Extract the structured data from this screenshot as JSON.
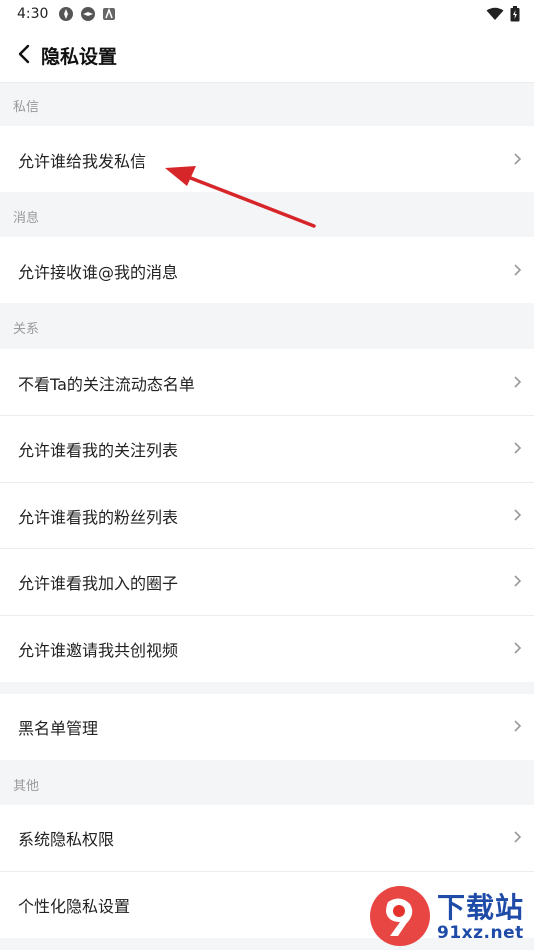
{
  "status_bar": {
    "time": "4:30"
  },
  "header": {
    "title": "隐私设置"
  },
  "sections": {
    "private_message": "私信",
    "messages": "消息",
    "relations": "关系",
    "other": "其他"
  },
  "items": {
    "allow_private_message": "允许谁给我发私信",
    "allow_at_messages": "允许接收谁@我的消息",
    "hide_following_list": "不看Ta的关注流动态名单",
    "view_following_list": "允许谁看我的关注列表",
    "view_fans_list": "允许谁看我的粉丝列表",
    "view_joined_circles": "允许谁看我加入的圈子",
    "invite_cocreate_video": "允许谁邀请我共创视频",
    "blacklist": "黑名单管理",
    "system_privacy": "系统隐私权限",
    "personalized_privacy": "个性化隐私设置"
  },
  "watermark": {
    "title": "下载站",
    "url": "91xz.net"
  },
  "colors": {
    "arrow": "#d7262a",
    "watermark_blue": "#1e4aa8",
    "watermark_red": "#e5322d"
  }
}
